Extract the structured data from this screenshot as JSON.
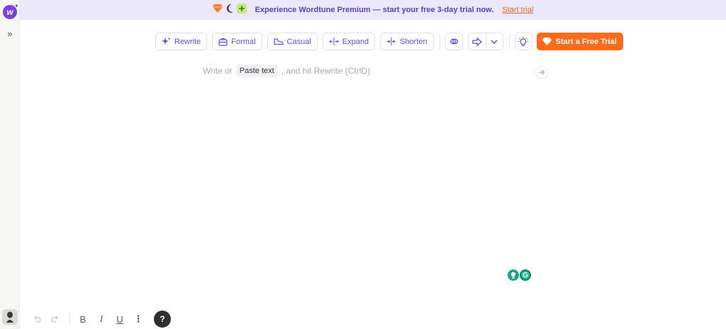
{
  "banner": {
    "text": "Experience Wordtune Premium — start your free 3-day trial now.",
    "link": "Start trial",
    "icons": [
      "diamond-icon",
      "moon-icon",
      "plus-badge-icon"
    ]
  },
  "toolbar": {
    "rewrite": "Rewrite",
    "formal": "Formal",
    "casual": "Casual",
    "expand": "Expand",
    "shorten": "Shorten",
    "cta": "Start a Free Trial"
  },
  "editor": {
    "placeholder_before": "Write or",
    "paste_label": "Paste text",
    "placeholder_after": ", and hit Rewrite (CtrlD)"
  },
  "format_bar": {
    "bold": "B",
    "italic": "I",
    "underline": "U",
    "help": "?"
  },
  "colors": {
    "accent": "#6a48d6",
    "banner_bg": "#ece8fb",
    "cta": "#ff6b1a",
    "link": "#f0672a"
  }
}
